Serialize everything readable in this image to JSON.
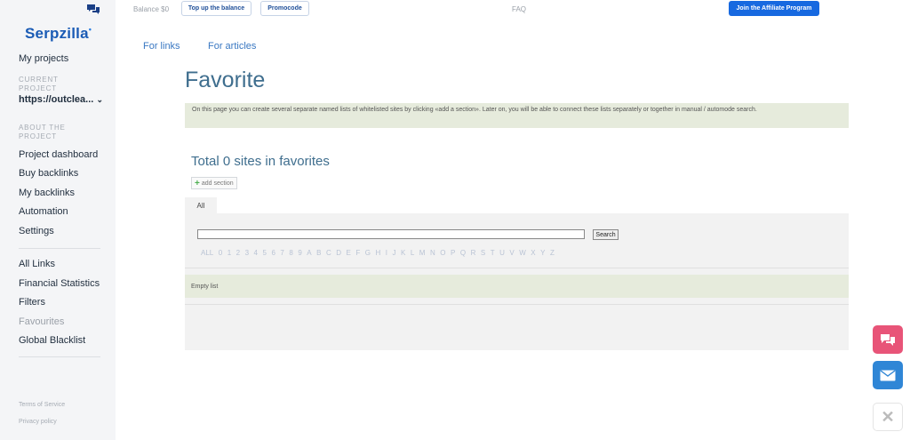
{
  "sidebar": {
    "logo": "Serpzilla",
    "logo_mark": "•",
    "my_projects": "My projects",
    "current_project_heading": "CURRENT PROJECT",
    "current_project": "https://outclea...",
    "about_heading": "ABOUT THE PROJECT",
    "project_items": [
      "Project dashboard",
      "Buy backlinks",
      "My backlinks",
      "Automation",
      "Settings"
    ],
    "global_items": [
      "All Links",
      "Financial Statistics",
      "Filters",
      "Favourites",
      "Global Blacklist"
    ],
    "footer": [
      "Terms of Service",
      "Privacy policy"
    ]
  },
  "topbar": {
    "balance": "Balance $0",
    "top_up": "Top up the balance",
    "promocode": "Promocode",
    "faq": "FAQ",
    "affiliate": "Join the Affiliate Program"
  },
  "tabs": [
    "For links",
    "For articles"
  ],
  "main": {
    "title": "Favorite",
    "info": "On this page you can create several separate named lists of whitelisted sites by clicking «add a section». Later on, you will be able to connect these lists separately or together in manual / automode search.",
    "total": "Total 0 sites in favorites",
    "add_section": "add section",
    "tab_all": "All",
    "search_button": "Search",
    "letters": [
      "ALL",
      "0",
      "1",
      "2",
      "3",
      "4",
      "5",
      "6",
      "7",
      "8",
      "9",
      "A",
      "B",
      "C",
      "D",
      "E",
      "F",
      "G",
      "H",
      "I",
      "J",
      "K",
      "L",
      "M",
      "N",
      "O",
      "P",
      "Q",
      "R",
      "S",
      "T",
      "U",
      "V",
      "W",
      "X",
      "Y",
      "Z"
    ],
    "empty": "Empty list"
  },
  "fab": {
    "close": "✕"
  },
  "colors": {
    "accent": "#1769e0",
    "chat": "#e85478",
    "mail": "#2f86d6",
    "title": "#3f6e8e"
  }
}
